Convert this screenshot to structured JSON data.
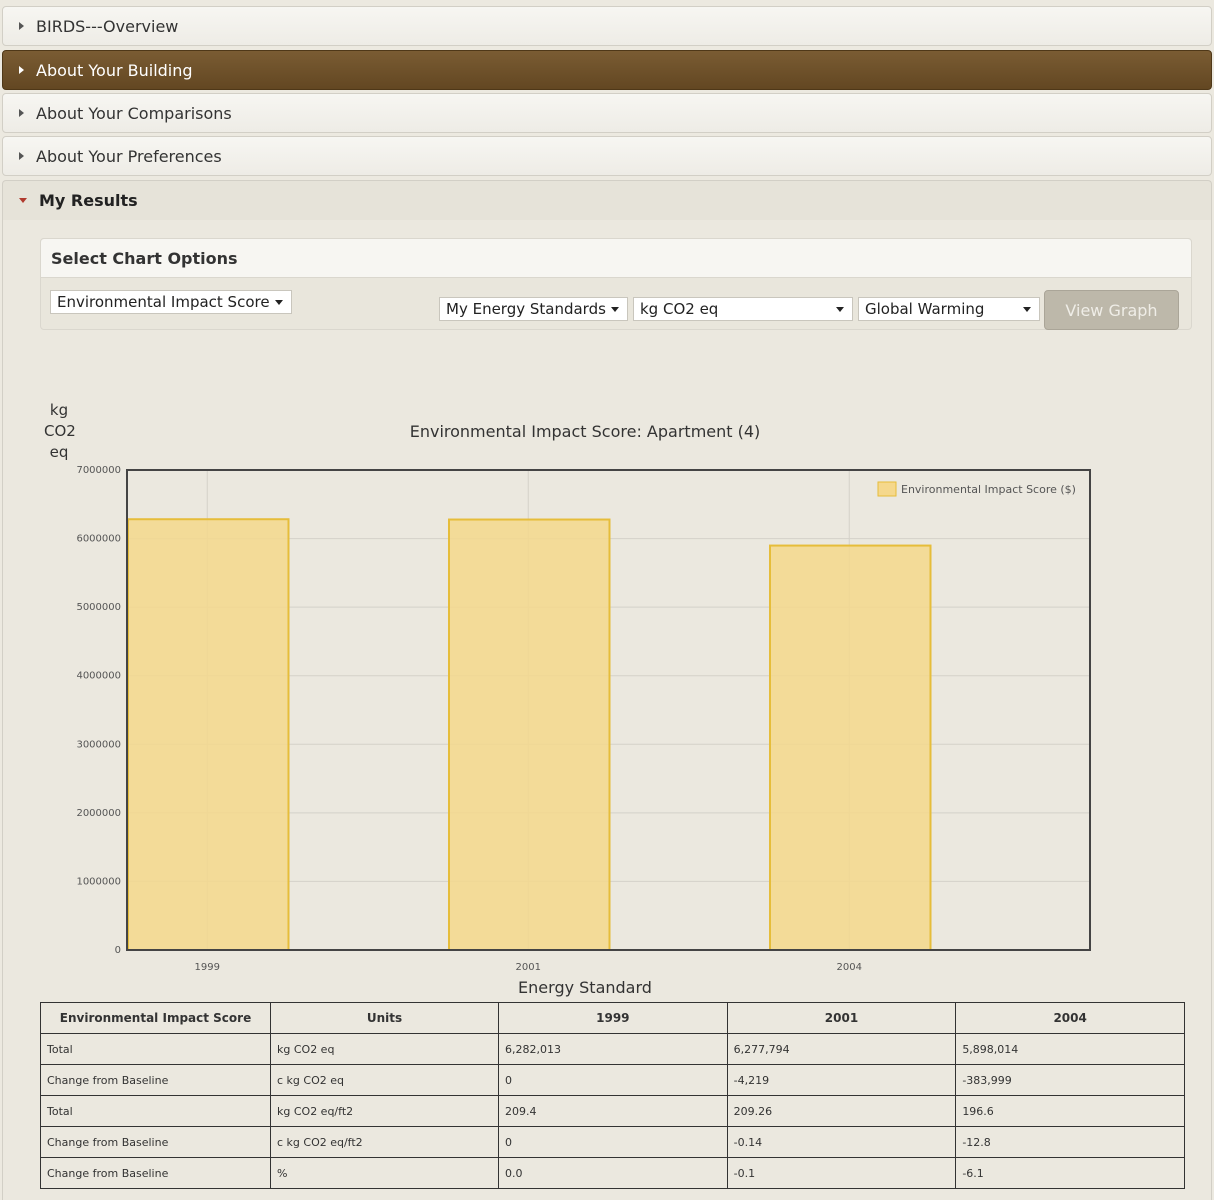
{
  "accordion": [
    {
      "label": "BIRDS---Overview"
    },
    {
      "label": "About Your Building"
    },
    {
      "label": "About Your Comparisons"
    },
    {
      "label": "About Your Preferences"
    },
    {
      "label": "My Results"
    }
  ],
  "options": {
    "heading": "Select Chart Options",
    "metric": "Environmental Impact Score",
    "standards": "My Energy Standards",
    "units": "kg CO2 eq",
    "category": "Global Warming",
    "view_button": "View Graph"
  },
  "colors": {
    "bar_fill": "#f5d88c",
    "bar_stroke": "#e6bd3a",
    "dark_header": "#6e522b"
  },
  "chart_data": {
    "type": "bar",
    "title": "Environmental Impact Score: Apartment (4)",
    "ylabel": "kg CO2 eq",
    "xlabel": "Energy Standard",
    "categories": [
      "1999",
      "2001",
      "2004"
    ],
    "series": [
      {
        "name": "Environmental Impact Score ($)",
        "values": [
          6282013,
          6277794,
          5898014
        ]
      }
    ],
    "ylim": [
      0,
      7000000
    ],
    "yticks": [
      "0",
      "1000000",
      "2000000",
      "3000000",
      "4000000",
      "5000000",
      "6000000",
      "7000000"
    ],
    "grid": true,
    "legend": "top-right"
  },
  "table": {
    "headers": [
      "Environmental Impact Score",
      "Units",
      "1999",
      "2001",
      "2004"
    ],
    "rows": [
      [
        "Total",
        "kg CO2 eq",
        "6,282,013",
        "6,277,794",
        "5,898,014"
      ],
      [
        "Change from Baseline",
        "c kg CO2 eq",
        "0",
        "-4,219",
        "-383,999"
      ],
      [
        "Total",
        "kg CO2 eq/ft2",
        "209.4",
        "209.26",
        "196.6"
      ],
      [
        "Change from Baseline",
        "c kg CO2 eq/ft2",
        "0",
        "-0.14",
        "-12.8"
      ],
      [
        "Change from Baseline",
        "%",
        "0.0",
        "-0.1",
        "-6.1"
      ]
    ]
  }
}
